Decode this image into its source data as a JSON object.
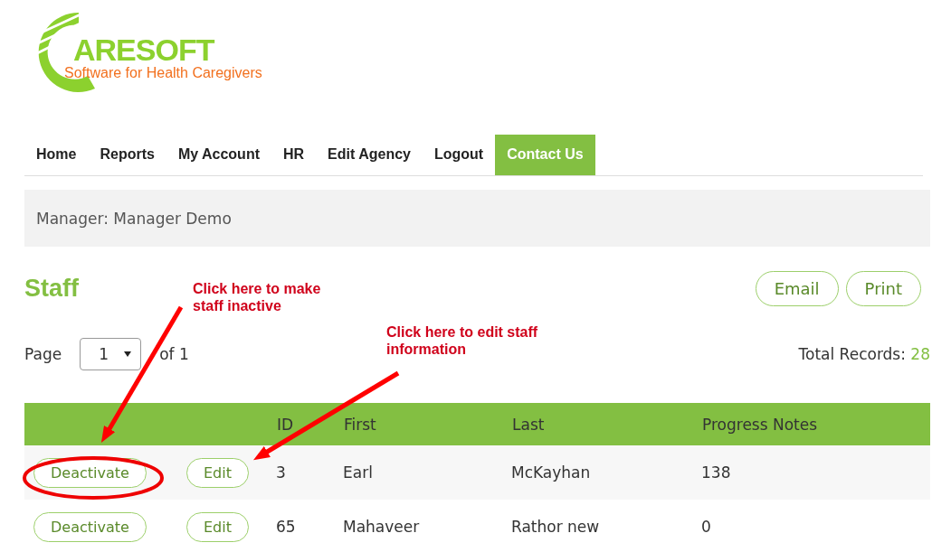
{
  "logo": {
    "name": "ARESOFT",
    "tagline": "Software for Health Caregivers"
  },
  "nav": [
    {
      "label": "Home",
      "selected": false
    },
    {
      "label": "Reports",
      "selected": false
    },
    {
      "label": "My Account",
      "selected": false
    },
    {
      "label": "HR",
      "selected": false
    },
    {
      "label": "Edit Agency",
      "selected": false
    },
    {
      "label": "Logout",
      "selected": false
    },
    {
      "label": "Contact Us",
      "selected": true
    }
  ],
  "manager_bar": "Manager: Manager Demo",
  "heading": "Staff",
  "header_buttons": [
    "Email",
    "Print"
  ],
  "pager": {
    "label": "Page",
    "value": "1",
    "suffix": "of 1"
  },
  "total": {
    "label": "Total Records:",
    "value": "28"
  },
  "table": {
    "columns": [
      "",
      "",
      "ID",
      "First",
      "Last",
      "Progress Notes"
    ],
    "rows": [
      {
        "cells": [
          "Deactivate",
          "Edit",
          "3",
          "Earl",
          "McKayhan",
          "138"
        ]
      },
      {
        "cells": [
          "Deactivate",
          "Edit",
          "65",
          "Mahaveer",
          "Rathor new",
          "0"
        ]
      }
    ]
  },
  "annotations": [
    "Click here to make staff inactive",
    "Click here to edit staff information"
  ]
}
